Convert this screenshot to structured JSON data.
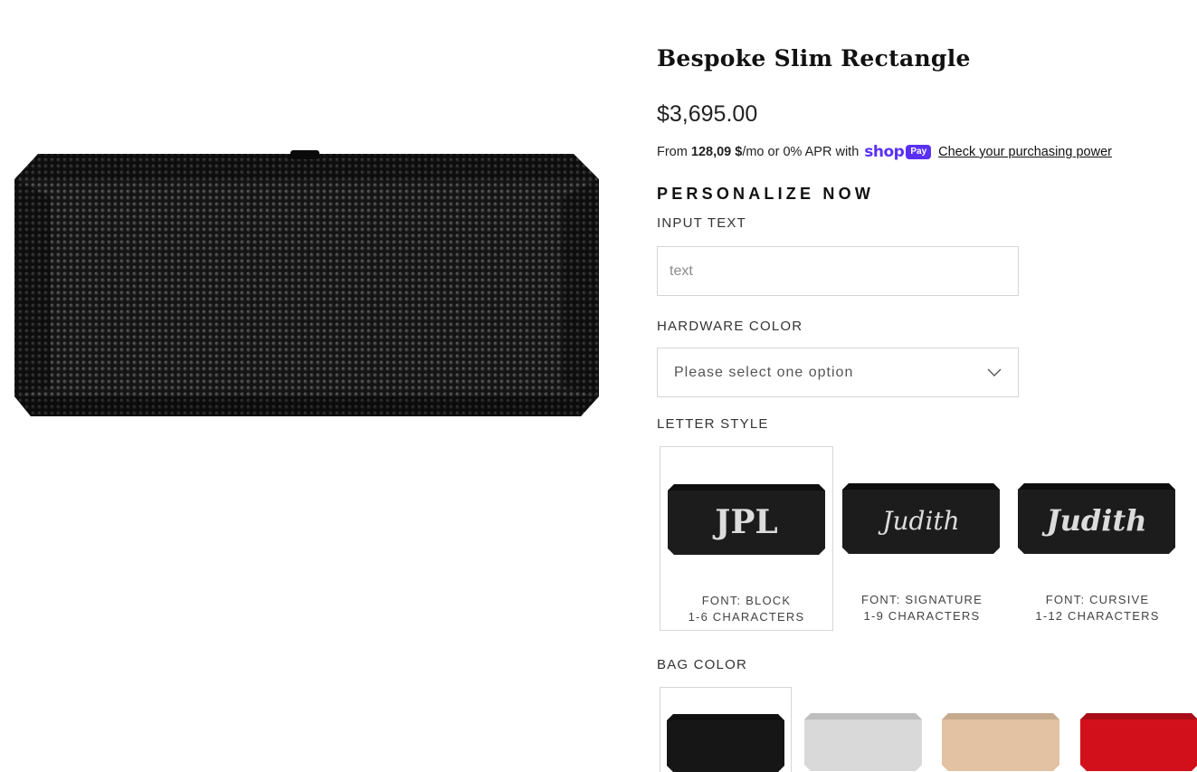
{
  "product": {
    "title": "Bespoke Slim Rectangle",
    "price": "$3,695.00",
    "main_image_icon": "black-crystal-clutch-image"
  },
  "financing": {
    "prefix": "From ",
    "amount": "128,09 $",
    "suffix": "/mo or 0% APR with",
    "brand_word": "shop",
    "brand_pill": "Pay",
    "brand_color": "#5a31f4",
    "link": "Check your purchasing power"
  },
  "personalize": {
    "heading": "PERSONALIZE NOW",
    "input_label": "INPUT TEXT",
    "input_placeholder": "text",
    "input_value": "",
    "hardware_label": "HARDWARE COLOR",
    "hardware_selected": "Please select one option",
    "letter_style_label": "LETTER STYLE",
    "letter_styles": [
      {
        "sample": "JPL",
        "line1": "FONT: BLOCK",
        "line2": "1-6 CHARACTERS",
        "selected": true
      },
      {
        "sample": "Judith",
        "line1": "FONT: SIGNATURE",
        "line2": "1-9 CHARACTERS",
        "selected": false
      },
      {
        "sample": "Judith",
        "line1": "FONT: CURSIVE",
        "line2": "1-12 CHARACTERS",
        "selected": false
      }
    ],
    "bag_color_label": "BAG COLOR",
    "bag_colors": [
      {
        "name": "black-bag-swatch",
        "hex": "#161616",
        "selected": true
      },
      {
        "name": "silver-bag-swatch",
        "hex": "#d9d9d9",
        "selected": false
      },
      {
        "name": "champagne-bag-swatch",
        "hex": "#e2c2a2",
        "selected": false
      },
      {
        "name": "red-bag-swatch",
        "hex": "#d2101c",
        "selected": false
      }
    ]
  }
}
